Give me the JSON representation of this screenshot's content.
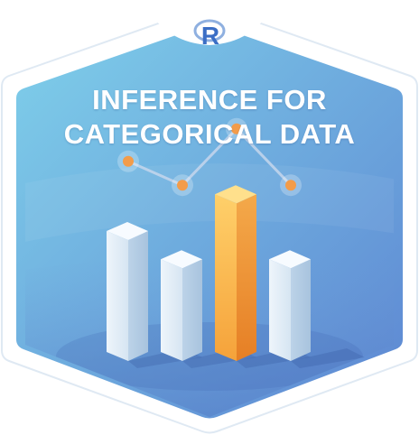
{
  "badge": {
    "title_line_1": "INFERENCE FOR",
    "title_line_2": "CATEGORICAL DATA",
    "logo_letter": "R",
    "logo_icon": "r-language-icon",
    "bar_icon": "bar-chart-icon",
    "line_icon": "line-chart-icon",
    "colors": {
      "background_top": "#7fcde9",
      "background_bottom": "#5f8fd6",
      "rim": "#ffffff",
      "rim_outline": "#dfe9f3",
      "bar_pale": "#dce9f4",
      "bar_highlight": "#f2a43f",
      "line": "#b9cbe3",
      "marker": "#f39c4a",
      "logo": "#3b6ec5"
    },
    "chart": {
      "bar_levels": [
        0.6,
        0.47,
        0.77,
        0.47
      ],
      "highlighted_bar": 2,
      "line_levels": [
        0.63,
        0.52,
        0.78,
        0.52
      ]
    }
  }
}
